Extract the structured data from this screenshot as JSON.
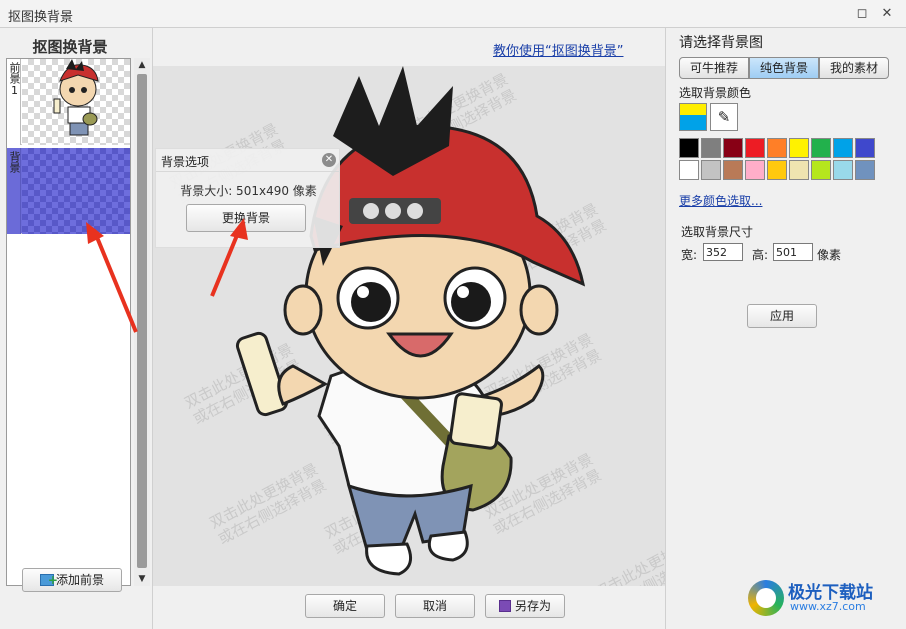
{
  "window": {
    "title": "抠图换背景"
  },
  "left_panel": {
    "title": "抠图换背景",
    "layers": [
      {
        "label": "前景1"
      },
      {
        "label": "背景"
      }
    ],
    "add_foreground_label": "添加前景"
  },
  "center": {
    "help_link": "教你使用“抠图换背景”",
    "watermark_line1": "双击此处更换背景",
    "watermark_line2": "或在右侧选择背景",
    "buttons": {
      "ok": "确定",
      "cancel": "取消",
      "save_as": "另存为"
    }
  },
  "popup": {
    "title": "背景选项",
    "size_text": "背景大小: 501x490 像素",
    "change_button": "更换背景"
  },
  "right_panel": {
    "title": "请选择背景图",
    "tabs": [
      {
        "label": "可牛推荐",
        "active": false
      },
      {
        "label": "纯色背景",
        "active": true
      },
      {
        "label": "我的素材",
        "active": false
      }
    ],
    "pick_color_label": "选取背景颜色",
    "current_color": {
      "primary": "#ffee00",
      "secondary": "#00a2e8"
    },
    "swatch_colors": [
      "#000000",
      "#7f7f7f",
      "#880015",
      "#ed1c24",
      "#ff7f27",
      "#fff200",
      "#22b14c",
      "#00a2e8",
      "#3f48cc",
      "#ffffff",
      "#c3c3c3",
      "#b97a57",
      "#ffaec9",
      "#ffc90e",
      "#efe4b0",
      "#b5e61d",
      "#99d9ea",
      "#7092be"
    ],
    "more_colors": "更多颜色选取...",
    "size_label": "选取背景尺寸",
    "width_label": "宽:",
    "width_value": "352",
    "height_label": "高:",
    "height_value": "501",
    "unit": "像素",
    "apply": "应用"
  },
  "site_logo": {
    "name": "极光下载站",
    "url": "www.xz7.com"
  }
}
